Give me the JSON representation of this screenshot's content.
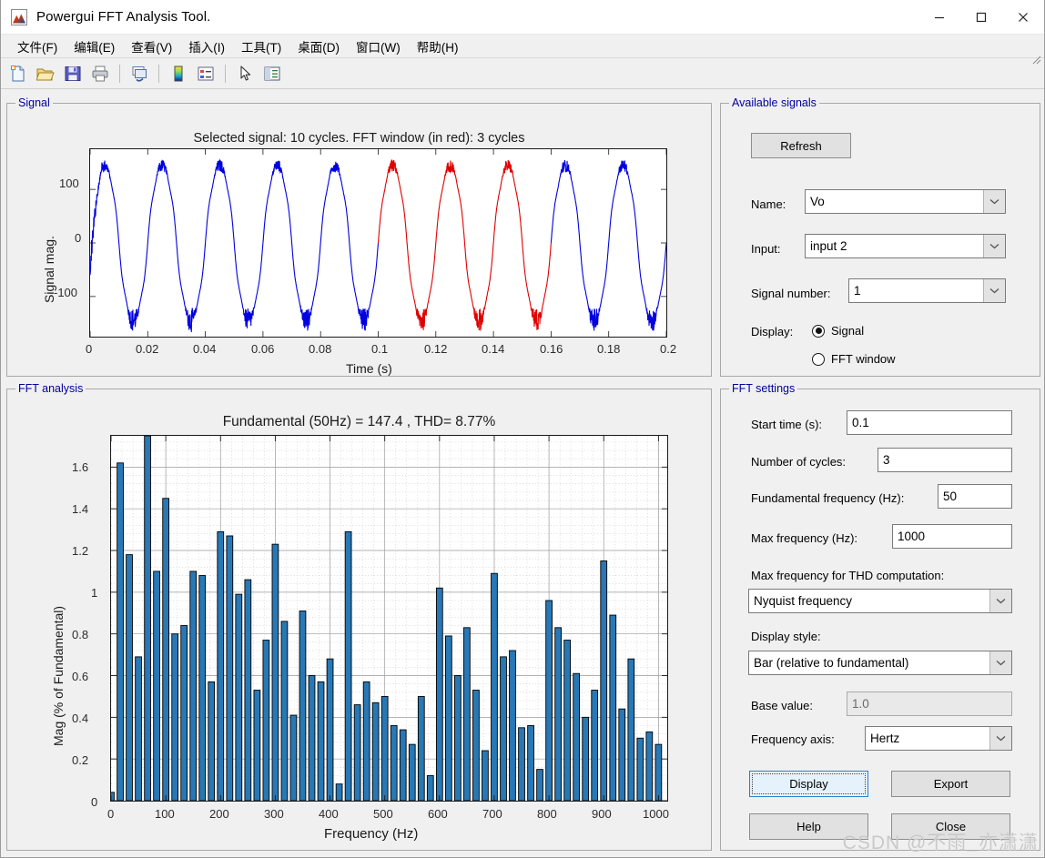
{
  "window": {
    "title": "Powergui FFT Analysis Tool.",
    "app_icon": "matlab-icon",
    "controls": {
      "minimize": "minimize-icon",
      "maximize": "maximize-icon",
      "close": "close-icon"
    }
  },
  "menubar": [
    {
      "label": "文件(F)",
      "mnemonic": "F"
    },
    {
      "label": "编辑(E)",
      "mnemonic": "E"
    },
    {
      "label": "查看(V)",
      "mnemonic": "V"
    },
    {
      "label": "插入(I)",
      "mnemonic": "I"
    },
    {
      "label": "工具(T)",
      "mnemonic": "T"
    },
    {
      "label": "桌面(D)",
      "mnemonic": "D"
    },
    {
      "label": "窗口(W)",
      "mnemonic": "W"
    },
    {
      "label": "帮助(H)",
      "mnemonic": "H"
    }
  ],
  "toolbar": [
    {
      "name": "new-figure-icon"
    },
    {
      "name": "open-file-icon"
    },
    {
      "name": "save-icon"
    },
    {
      "name": "print-icon"
    },
    {
      "name": "link-plot-icon"
    },
    {
      "name": "colorbar-icon"
    },
    {
      "name": "legend-icon"
    },
    {
      "name": "pointer-icon"
    },
    {
      "name": "property-editor-icon"
    }
  ],
  "panels": {
    "signal": "Signal",
    "fft_analysis": "FFT analysis",
    "available_signals": "Available signals",
    "fft_settings": "FFT settings"
  },
  "available_signals": {
    "refresh_label": "Refresh",
    "name_label": "Name:",
    "name_value": "Vo",
    "input_label": "Input:",
    "input_value": "input 2",
    "signal_number_label": "Signal number:",
    "signal_number_value": "1",
    "display_label": "Display:",
    "display_options": [
      {
        "label": "Signal",
        "selected": true
      },
      {
        "label": "FFT window",
        "selected": false
      }
    ]
  },
  "fft_settings": {
    "start_time_label": "Start time (s):",
    "start_time_value": "0.1",
    "cycles_label": "Number of cycles:",
    "cycles_value": "3",
    "fundamental_label": "Fundamental frequency (Hz):",
    "fundamental_value": "50",
    "max_freq_label": "Max frequency (Hz):",
    "max_freq_value": "1000",
    "max_freq_thd_label": "Max frequency for THD computation:",
    "max_freq_thd_value": "Nyquist frequency",
    "display_style_label": "Display style:",
    "display_style_value": "Bar (relative to fundamental)",
    "base_value_label": "Base value:",
    "base_value_value": "1.0",
    "freq_axis_label": "Frequency axis:",
    "freq_axis_value": "Hertz",
    "buttons": {
      "display": "Display",
      "export": "Export",
      "help": "Help",
      "close": "Close"
    }
  },
  "watermark": "CSDN @不雨_亦潇潇",
  "chart_data": [
    {
      "id": "signal-plot",
      "type": "line",
      "title": "Selected signal: 10 cycles. FFT window (in red): 3 cycles",
      "xlabel": "Time (s)",
      "ylabel": "Signal mag.",
      "xlim": [
        0,
        0.2
      ],
      "ylim": [
        -175,
        175
      ],
      "xticks": [
        0,
        0.02,
        0.04,
        0.06,
        0.08,
        0.1,
        0.12,
        0.14,
        0.16,
        0.18,
        0.2
      ],
      "xticklabels": [
        "0",
        "0.02",
        "0.04",
        "0.06",
        "0.08",
        "0.1",
        "0.12",
        "0.14",
        "0.16",
        "0.18",
        "0.2"
      ],
      "yticks": [
        -100,
        0,
        100
      ],
      "yticklabels": [
        "-100",
        "0",
        "100"
      ],
      "grid": false,
      "series": [
        {
          "name": "signal",
          "color": "#0000e0",
          "amplitude": 150,
          "frequency_hz": 50,
          "cycles": 10
        },
        {
          "name": "fft-window",
          "color": "#e00000",
          "t_start": 0.1,
          "t_end": 0.16,
          "cycles": 3
        }
      ]
    },
    {
      "id": "fft-bar-plot",
      "type": "bar",
      "title": "Fundamental (50Hz) = 147.4 , THD= 8.77%",
      "xlabel": "Frequency (Hz)",
      "ylabel": "Mag (% of Fundamental)",
      "xlim": [
        0,
        1016
      ],
      "ylim": [
        0,
        1.75
      ],
      "xticks": [
        0,
        100,
        200,
        300,
        400,
        500,
        600,
        700,
        800,
        900,
        1000
      ],
      "xticklabels": [
        "0",
        "100",
        "200",
        "300",
        "400",
        "500",
        "600",
        "700",
        "800",
        "900",
        "1000"
      ],
      "yticks": [
        0,
        0.2,
        0.4,
        0.6,
        0.8,
        1,
        1.2,
        1.4,
        1.6
      ],
      "yticklabels": [
        "0",
        "0.2",
        "0.4",
        "0.6",
        "0.8",
        "1",
        "1.2",
        "1.4",
        "1.6"
      ],
      "grid": true,
      "bar_color": "#2878b5",
      "bar_edge": "#000000",
      "bin_width_hz": 16.667,
      "x": [
        0,
        16.7,
        33.3,
        50,
        66.7,
        83.3,
        100,
        116.7,
        133.3,
        150,
        166.7,
        183.3,
        200,
        216.7,
        233.3,
        250,
        266.7,
        283.3,
        300,
        316.7,
        333.3,
        350,
        366.7,
        383.3,
        400,
        416.7,
        433.3,
        450,
        466.7,
        483.3,
        500,
        516.7,
        533.3,
        550,
        566.7,
        583.3,
        600,
        616.7,
        633.3,
        650,
        666.7,
        683.3,
        700,
        716.7,
        733.3,
        750,
        766.7,
        783.3,
        800,
        816.7,
        833.3,
        850,
        866.7,
        883.3,
        900,
        916.7,
        933.3,
        950,
        966.7,
        983.3,
        1000
      ],
      "values": [
        0.04,
        1.62,
        1.18,
        0.69,
        1.75,
        1.1,
        1.45,
        0.8,
        0.84,
        1.1,
        1.08,
        0.57,
        1.29,
        1.27,
        0.99,
        1.06,
        0.53,
        0.77,
        1.23,
        0.86,
        0.41,
        0.91,
        0.6,
        0.57,
        0.68,
        0.08,
        1.29,
        0.46,
        0.57,
        0.47,
        0.5,
        0.36,
        0.34,
        0.27,
        0.5,
        0.12,
        1.02,
        0.79,
        0.6,
        0.83,
        0.53,
        0.24,
        1.09,
        0.69,
        0.72,
        0.35,
        0.36,
        0.15,
        0.96,
        0.83,
        0.77,
        0.61,
        0.4,
        0.53,
        1.15,
        0.89,
        0.44,
        0.68,
        0.3,
        0.33,
        0.27
      ]
    }
  ]
}
